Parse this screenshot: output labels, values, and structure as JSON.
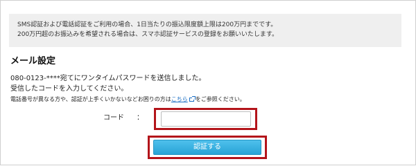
{
  "notice": {
    "line1": "SMS認証および電話認証をご利用の場合、1日当たりの振込限度額上限は200万円までです。",
    "line2": "200万円超のお振込みを希望される場合は、スマホ認証サービスの登録をお願いいたします。"
  },
  "section": {
    "title": "メール設定",
    "message1": "080-0123-****宛てにワンタイムパスワードを送信しました。",
    "message2": "受信したコードを入力してください。",
    "help_before": "電話番号が異なる方や、認証が上手くいかないなどお困りの方は",
    "help_link": "こちら",
    "help_after": "をご参照ください。"
  },
  "form": {
    "code_label": "コード",
    "colon": "：",
    "code_value": "",
    "code_placeholder": "",
    "submit_label": "認証する"
  },
  "colors": {
    "highlight": "#b3141a",
    "button": "#28a4d6",
    "link": "#1a6ec4",
    "notice_bg": "#efefef"
  }
}
